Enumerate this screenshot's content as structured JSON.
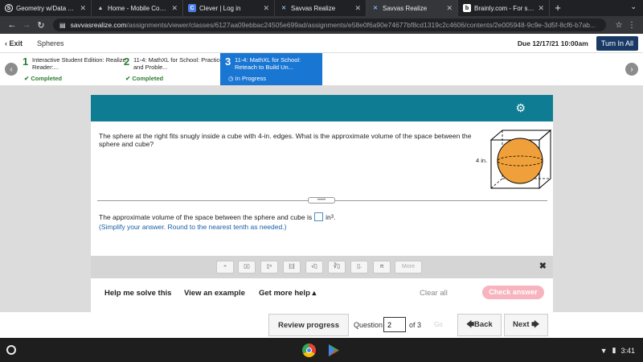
{
  "browser": {
    "tabs": [
      {
        "title": "Geometry w/Data Anal",
        "favicon": "S",
        "fav_color": "#ffffff"
      },
      {
        "title": "Home - Mobile County",
        "favicon": "▲",
        "fav_color": "#cccccc"
      },
      {
        "title": "Clever | Log in",
        "favicon": "C",
        "fav_color": "#4a7fe8"
      },
      {
        "title": "Savvas Realize",
        "favicon": "✕",
        "fav_color": "#8ab4f8"
      },
      {
        "title": "Savvas Realize",
        "favicon": "✕",
        "fav_color": "#8ab4f8"
      },
      {
        "title": "Brainly.com - For stude",
        "favicon": "b",
        "fav_color": "#000000"
      }
    ],
    "new_tab": "+",
    "url_host": "savvasrealize.com",
    "url_path": "/assignments/viewer/classes/6127aa09ebbac24505e699ad/assignments/e58e0f6a90e74677bf8cd1319c2c4606/contents/2e005948-9c9e-3d5f-8cf6-b7ab..."
  },
  "header": {
    "exit": "Exit",
    "breadcrumb": "Spheres",
    "due": "Due 12/17/21 10:00am",
    "turn_in": "Turn In All"
  },
  "steps": [
    {
      "num": "1",
      "title": "Interactive Student Edition: Realize Reader:...",
      "status": "Completed"
    },
    {
      "num": "2",
      "title": "11-4: MathXL for School: Practice and Proble...",
      "status": "Completed"
    },
    {
      "num": "3",
      "title": "11-4: MathXL for School: Reteach to Build Un...",
      "status": "In Progress"
    }
  ],
  "question": {
    "text": "The sphere at the right fits snugly inside a cube with 4-in. edges. What is the approximate volume of the space between the sphere and cube?",
    "figure_label": "4 in.",
    "answer_prefix": "The approximate volume of the space between the sphere and cube is",
    "answer_unit": "in",
    "answer_unit_exp": "3",
    "answer_suffix": ".",
    "note": "(Simplify your answer. Round to the nearest tenth as needed.)",
    "handle": "•••••"
  },
  "toolbar": {
    "tools": [
      "÷",
      "▯▯",
      "▯ⁿ",
      "|▯|",
      "√▯",
      "∛▯",
      "▯.",
      "π"
    ],
    "more": "More",
    "close": "✖"
  },
  "help": {
    "help_solve": "Help me solve this",
    "example": "View an example",
    "more_help": "Get more help ▴",
    "clear_all": "Clear all",
    "check": "Check answer"
  },
  "nav": {
    "review": "Review progress",
    "question_label": "Question",
    "question_value": "2",
    "of": "of 3",
    "go": "Go",
    "back": "🡄Back",
    "next": "Next 🡆"
  },
  "shelf": {
    "time": "3:41",
    "wifi": "▼",
    "battery": "▮"
  }
}
